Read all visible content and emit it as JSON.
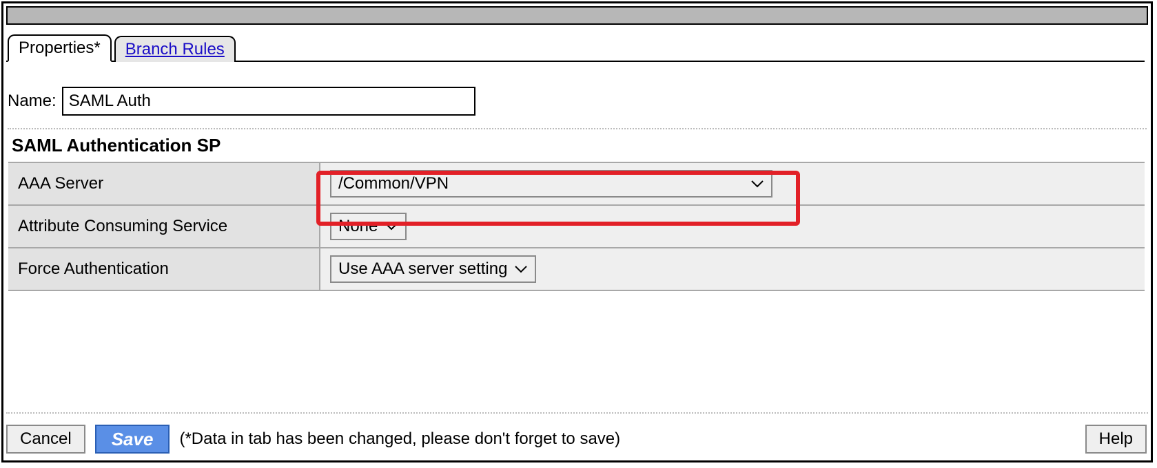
{
  "tabs": {
    "active": "Properties*",
    "inactive": "Branch Rules"
  },
  "nameRow": {
    "label": "Name:",
    "value": "SAML Auth"
  },
  "section": {
    "title": "SAML Authentication SP",
    "rows": {
      "aaaServer": {
        "label": "AAA Server",
        "value": "/Common/VPN"
      },
      "acs": {
        "label": "Attribute Consuming Service",
        "value": "None"
      },
      "forceAuth": {
        "label": "Force Authentication",
        "value": "Use AAA server setting"
      }
    }
  },
  "footer": {
    "cancel": "Cancel",
    "save": "Save",
    "note": "(*Data in tab has been changed, please don't forget to save)",
    "help": "Help"
  }
}
